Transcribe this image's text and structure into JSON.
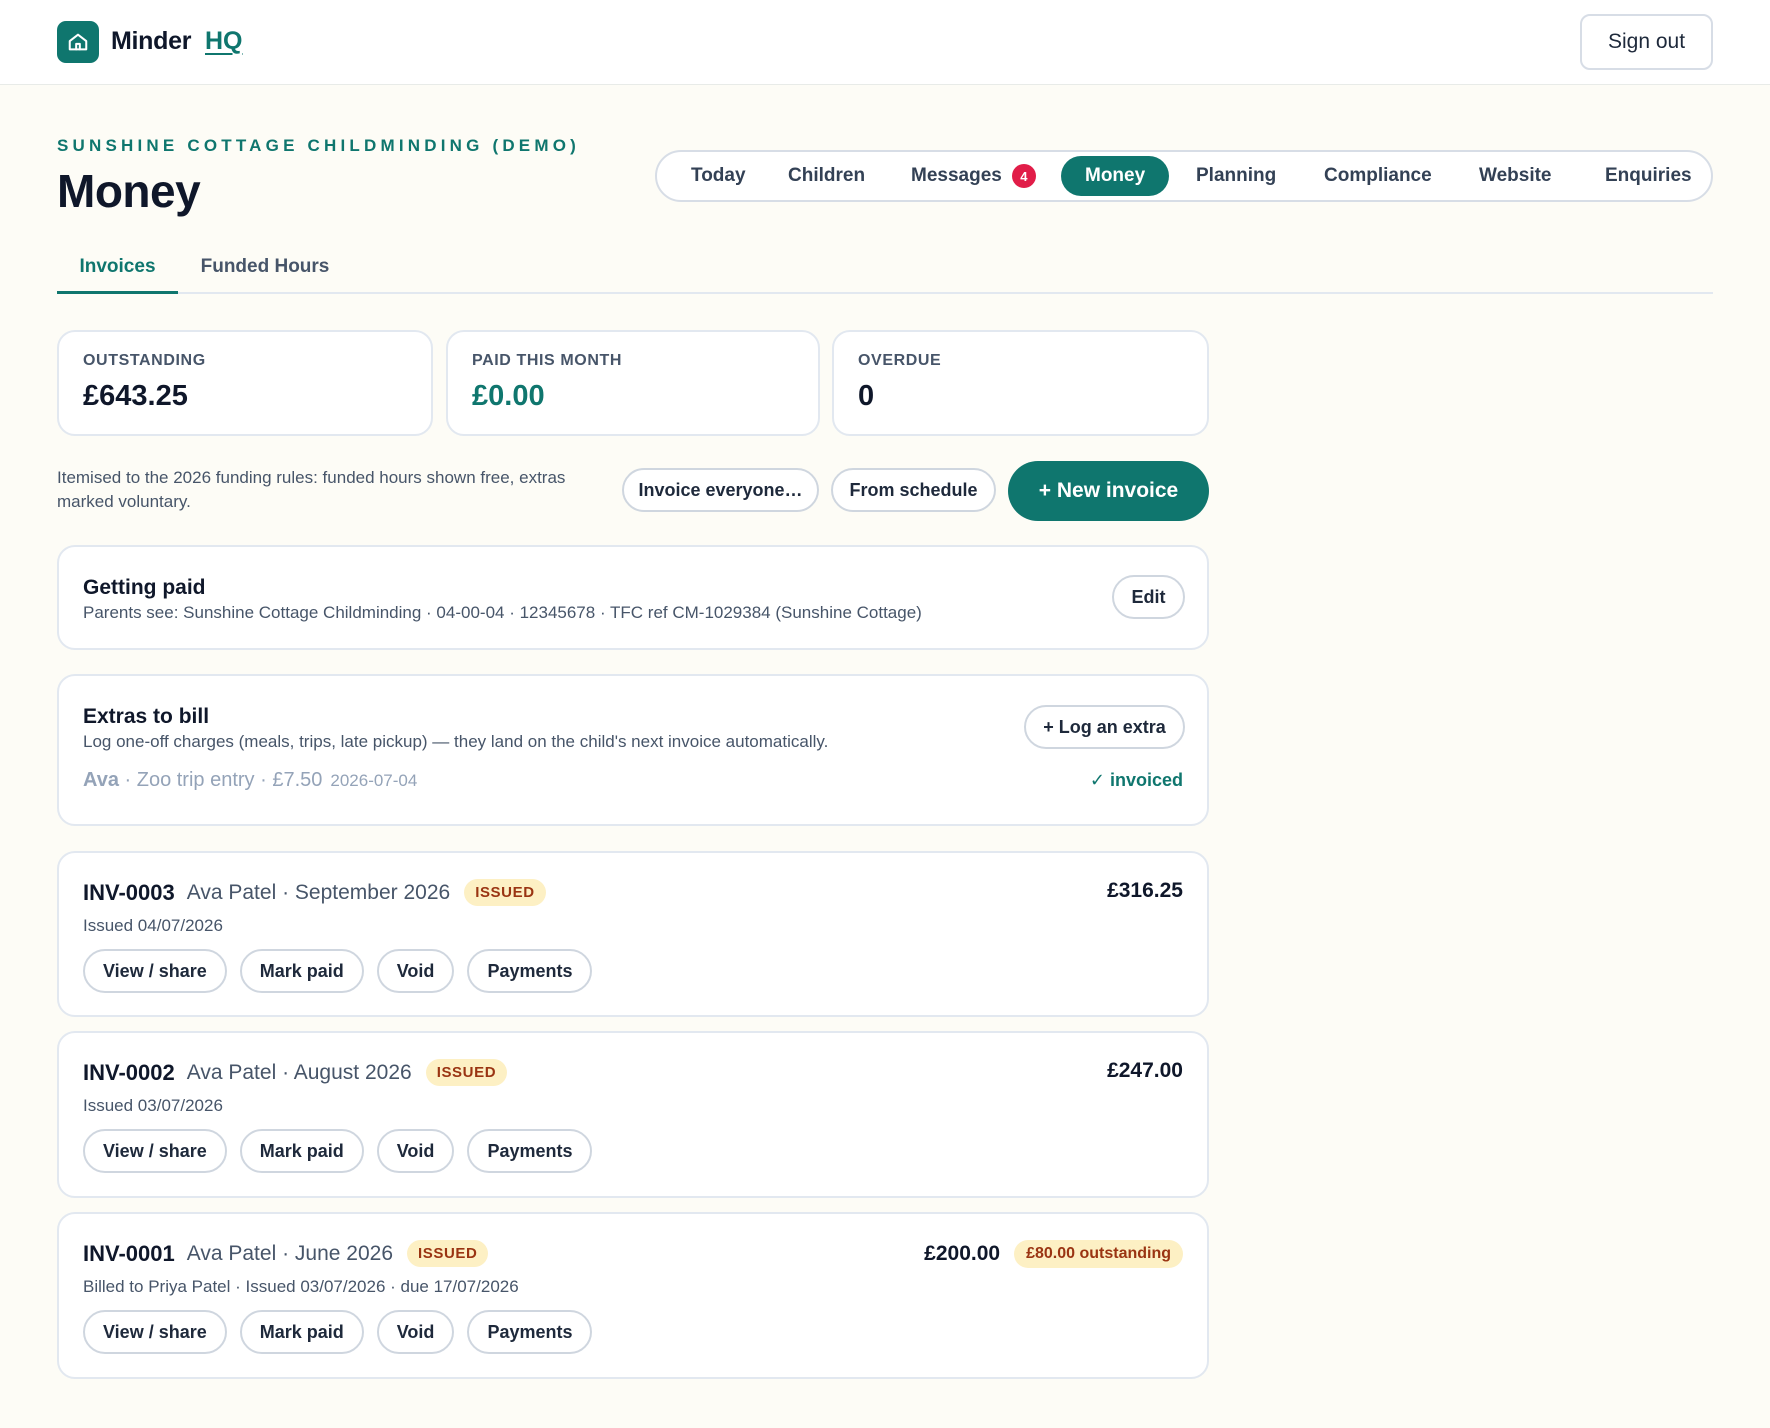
{
  "header": {
    "brand": "Minder",
    "brand_suffix": "HQ",
    "sign_out": "Sign out",
    "logo_icon": "house-icon"
  },
  "page": {
    "org": "SUNSHINE COTTAGE CHILDMINDING (DEMO)",
    "title": "Money"
  },
  "nav": {
    "items": [
      {
        "label": "Today"
      },
      {
        "label": "Children"
      },
      {
        "label": "Messages",
        "badge": "4"
      },
      {
        "label": "Money",
        "active": true
      },
      {
        "label": "Planning"
      },
      {
        "label": "Compliance"
      },
      {
        "label": "Website"
      },
      {
        "label": "Enquiries"
      }
    ]
  },
  "subtabs": [
    {
      "label": "Invoices",
      "active": true
    },
    {
      "label": "Funded Hours"
    }
  ],
  "stats": [
    {
      "label": "OUTSTANDING",
      "value": "£643.25"
    },
    {
      "label": "PAID THIS MONTH",
      "value": "£0.00"
    },
    {
      "label": "OVERDUE",
      "value": "0"
    }
  ],
  "toolbar": {
    "note": "Itemised to the 2026 funding rules: funded hours shown free, extras marked voluntary.",
    "invoice_everyone": "Invoice everyone…",
    "from_schedule": "From schedule",
    "new_invoice": "+ New invoice"
  },
  "getting_paid": {
    "title": "Getting paid",
    "details": "Parents see: Sunshine Cottage Childminding · 04-00-04 · 12345678 · TFC ref CM-1029384 (Sunshine Cottage)",
    "edit": "Edit"
  },
  "extras": {
    "title": "Extras to bill",
    "description": "Log one-off charges (meals, trips, late pickup) — they land on the child's next invoice automatically.",
    "log_button": "+ Log an extra",
    "items": [
      {
        "child": "Ava",
        "desc": " · Zoo trip entry · £7.50",
        "date": "2026-07-04",
        "status": "✓ invoiced"
      }
    ]
  },
  "invoices": [
    {
      "number": "INV-0003",
      "who": "Ava Patel · September 2026",
      "status": "ISSUED",
      "amount": "£316.25",
      "sub": "Issued 04/07/2026",
      "outstanding": ""
    },
    {
      "number": "INV-0002",
      "who": "Ava Patel · August 2026",
      "status": "ISSUED",
      "amount": "£247.00",
      "sub": "Issued 03/07/2026",
      "outstanding": ""
    },
    {
      "number": "INV-0001",
      "who": "Ava Patel · June 2026",
      "status": "ISSUED",
      "amount": "£200.00",
      "sub": "Billed to Priya Patel · Issued 03/07/2026 · due 17/07/2026",
      "outstanding": "£80.00 outstanding"
    }
  ],
  "invoice_actions": {
    "view": "View / share",
    "mark_paid": "Mark paid",
    "void": "Void",
    "payments": "Payments"
  },
  "colors": {
    "brand": "#0f766e",
    "background": "#fdfcf6",
    "badge": "#e11d48",
    "issued_bg": "#fdf0c4",
    "issued_text": "#9a3412"
  }
}
